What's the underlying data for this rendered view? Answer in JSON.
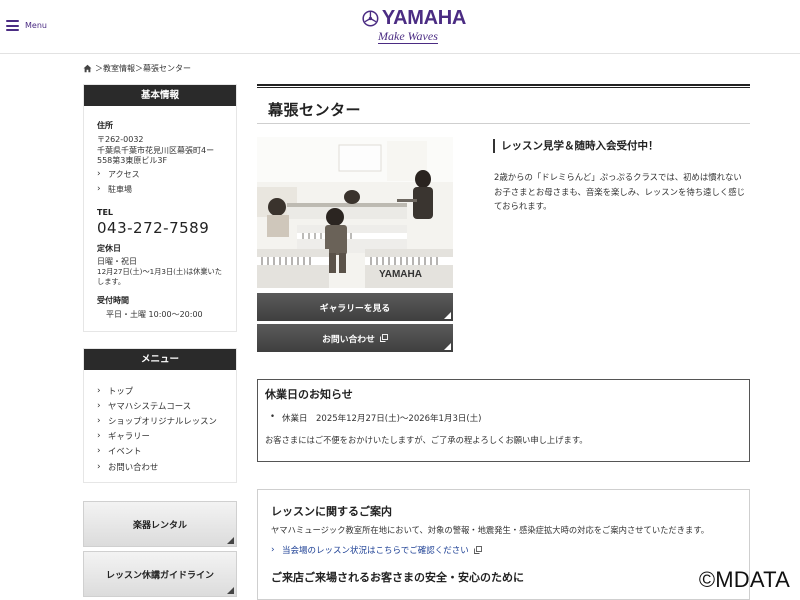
{
  "header": {
    "menu_label": "Menu",
    "logo_text": "YAMAHA",
    "logo_tagline": "Make Waves",
    "brand_color": "#4b2c83"
  },
  "breadcrumb": {
    "icon": "home-icon",
    "text": "＞教室情報＞幕張センター"
  },
  "sidebar": {
    "info": {
      "title": "基本情報",
      "address_label": "住所",
      "postal": "〒262-0032",
      "address_line1": "千葉県千葉市花見川区幕張町4ー",
      "address_line2": "558第3東原ビル3F",
      "links": [
        "アクセス",
        "駐車場"
      ],
      "tel_label": "TEL",
      "tel": "043-272-7589",
      "holiday_label": "定休日",
      "holiday_line1": "日曜・祝日",
      "holiday_line2": "12月27日(土)～1月3日(土)は休業いた",
      "holiday_line3": "します。",
      "hours_label": "受付時間",
      "hours": "平日・土曜 10:00～20:00"
    },
    "menu": {
      "title": "メニュー",
      "items": [
        "トップ",
        "ヤマハシステムコース",
        "ショップオリジナルレッスン",
        "ギャラリー",
        "イベント",
        "お問い合わせ"
      ]
    },
    "buttons": [
      "楽器レンタル",
      "レッスン休講ガイドライン"
    ]
  },
  "main": {
    "title": "幕張センター",
    "gallery_button": "ギャラリーを見る",
    "contact_button": "お問い合わせ",
    "lesson_heading": "レッスン見学＆随時入会受付中！",
    "lesson_text": "2歳からの「ドレミらんど」ぷっぷるクラスでは、初めは慣れないお子さまとお母さまも、音楽を楽しみ、レッスンを待ち遠しく感じておられます。",
    "notice": {
      "title": "休業日のお知らせ",
      "bullet": "休業日　2025年12月27日(土)～2026年1月3日(土)",
      "note": "お客さまにはご不便をおかけいたしますが、ご了承の程よろしくお願い申し上げます。"
    },
    "guide": {
      "title": "レッスンに関するご案内",
      "text": "ヤマハミュージック教室所在地において、対象の警報・地震発生・感染症拡大時の対応をご案内させていただきます。",
      "link": "当会場のレッスン状況はこちらでご確認ください",
      "title2": "ご来店ご来場されるお客さまの安全・安心のために"
    }
  },
  "watermark": "©MDATA"
}
